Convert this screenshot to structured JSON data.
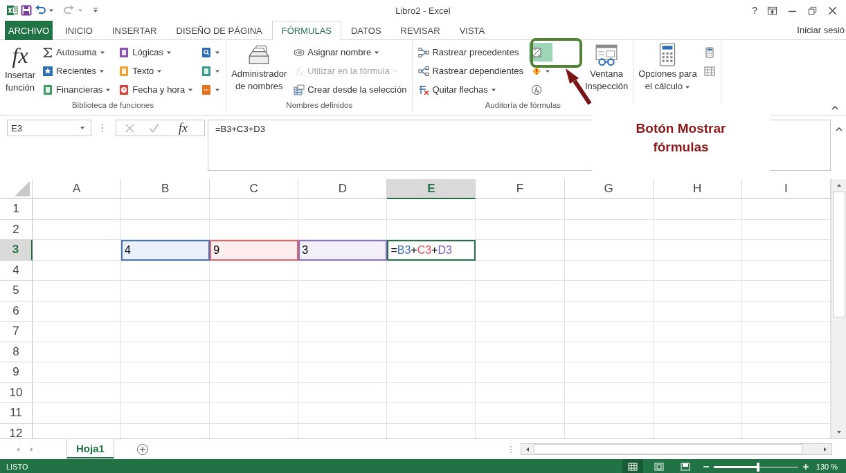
{
  "title_bar": {
    "title": "Libro2 - Excel",
    "help": "?"
  },
  "tabs": [
    {
      "label": "ARCHIVO",
      "kind": "file",
      "selected": false
    },
    {
      "label": "INICIO",
      "kind": "tab",
      "selected": false
    },
    {
      "label": "INSERTAR",
      "kind": "tab",
      "selected": false
    },
    {
      "label": "DISEÑO DE PÁGINA",
      "kind": "tab",
      "selected": false
    },
    {
      "label": "FÓRMULAS",
      "kind": "tab",
      "selected": true
    },
    {
      "label": "DATOS",
      "kind": "tab",
      "selected": false
    },
    {
      "label": "REVISAR",
      "kind": "tab",
      "selected": false
    },
    {
      "label": "VISTA",
      "kind": "tab",
      "selected": false
    }
  ],
  "account": "Iniciar sesió",
  "ribbon": {
    "groups": [
      {
        "label": "Biblioteca de funciones",
        "columns": [
          {
            "kind": "large",
            "icon_text": "fx",
            "label": "Insertar\nfunción",
            "dropdown": false
          },
          {
            "kind": "small",
            "items": [
              {
                "label": "Autosuma",
                "dropdown": true,
                "disabled": false,
                "on": false
              },
              {
                "label": "Recientes",
                "dropdown": true,
                "disabled": false,
                "on": false
              },
              {
                "label": "Financieras",
                "dropdown": true,
                "disabled": false,
                "on": false
              }
            ]
          },
          {
            "kind": "small",
            "items": [
              {
                "label": "Lógicas",
                "dropdown": true,
                "disabled": false,
                "on": false
              },
              {
                "label": "Texto",
                "dropdown": true,
                "disabled": false,
                "on": false
              },
              {
                "label": "Fecha y hora",
                "dropdown": true,
                "disabled": false,
                "on": false
              }
            ]
          },
          {
            "kind": "small",
            "items": [
              {
                "dropdown": true,
                "disabled": false,
                "on": false
              },
              {
                "dropdown": true,
                "disabled": false,
                "on": false
              },
              {
                "dropdown": true,
                "disabled": false,
                "on": false
              }
            ]
          }
        ]
      },
      {
        "label": "Nombres definidos",
        "columns": [
          {
            "kind": "large",
            "label": "Administrador\nde nombres",
            "dropdown": false
          },
          {
            "kind": "small",
            "items": [
              {
                "label": "Asignar nombre",
                "dropdown": true,
                "disabled": false,
                "on": false
              },
              {
                "label": "Utilizar en la fórmula",
                "dropdown": true,
                "disabled": true,
                "on": false
              },
              {
                "label": "Crear desde la selección",
                "dropdown": false,
                "disabled": false,
                "on": false
              }
            ]
          }
        ]
      },
      {
        "label": "Auditoría de fórmulas",
        "columns": [
          {
            "kind": "small",
            "items": [
              {
                "label": "Rastrear precedentes",
                "dropdown": false,
                "disabled": false,
                "on": false
              },
              {
                "label": "Rastrear dependientes",
                "dropdown": false,
                "disabled": false,
                "on": false
              },
              {
                "label": "Quitar flechas",
                "dropdown": true,
                "disabled": false,
                "on": false
              }
            ]
          },
          {
            "kind": "small",
            "items": [
              {
                "dropdown": false,
                "disabled": false,
                "on": true
              },
              {
                "dropdown": true,
                "disabled": false,
                "on": false
              },
              {
                "dropdown": false,
                "disabled": false,
                "on": false
              }
            ]
          },
          {
            "kind": "large",
            "label": "Ventana\nInspección",
            "dropdown": false
          }
        ]
      },
      {
        "columns": [
          {
            "kind": "large",
            "label": "Opciones para\nel cálculo",
            "dropdown": true
          },
          {
            "kind": "small",
            "items": [
              {
                "dropdown": false,
                "disabled": false,
                "on": false
              },
              {
                "dropdown": false,
                "disabled": false,
                "on": false
              }
            ]
          }
        ]
      }
    ]
  },
  "formula_bar": {
    "name_box": "E3",
    "fx": "fx",
    "formula": "=B3+C3+D3"
  },
  "grid": {
    "columns": [
      {
        "label": "A",
        "selected": false
      },
      {
        "label": "B",
        "selected": false
      },
      {
        "label": "C",
        "selected": false
      },
      {
        "label": "D",
        "selected": false
      },
      {
        "label": "E",
        "selected": true
      },
      {
        "label": "F",
        "selected": false
      },
      {
        "label": "G",
        "selected": false
      },
      {
        "label": "H",
        "selected": false
      },
      {
        "label": "I",
        "selected": false
      }
    ],
    "rows": [
      {
        "label": "1",
        "selected": false
      },
      {
        "label": "2",
        "selected": false
      },
      {
        "label": "3",
        "selected": true,
        "cells": [
          {
            "kind": "empty",
            "selected": false
          },
          {
            "kind": "value",
            "text": "4",
            "color": "#4472c4",
            "selected": false
          },
          {
            "kind": "value",
            "text": "9",
            "color": "#e06666",
            "selected": false
          },
          {
            "kind": "value",
            "text": "3",
            "color": "#8e6fc8",
            "selected": false
          },
          {
            "kind": "formula",
            "selected": true,
            "tokens": [
              {
                "text": "=",
                "color": "#000000"
              },
              {
                "text": "B3",
                "color": "#4472c4"
              },
              {
                "text": "+",
                "color": "#000000"
              },
              {
                "text": "C3",
                "color": "#e0504f"
              },
              {
                "text": "+",
                "color": "#000000"
              },
              {
                "text": "D3",
                "color": "#7e5fbf"
              }
            ]
          },
          {
            "kind": "empty",
            "selected": false
          },
          {
            "kind": "empty",
            "selected": false
          },
          {
            "kind": "empty",
            "selected": false
          },
          {
            "kind": "empty",
            "selected": false
          }
        ]
      },
      {
        "label": "4",
        "selected": false
      },
      {
        "label": "5",
        "selected": false
      },
      {
        "label": "6",
        "selected": false
      },
      {
        "label": "7",
        "selected": false
      },
      {
        "label": "8",
        "selected": false
      },
      {
        "label": "9",
        "selected": false
      },
      {
        "label": "10",
        "selected": false
      },
      {
        "label": "11",
        "selected": false
      },
      {
        "label": "12",
        "selected": false
      }
    ]
  },
  "sheets": [
    {
      "label": "Hoja1",
      "selected": true
    }
  ],
  "status_bar": {
    "status": "LISTO",
    "views": [
      {
        "selected": true
      },
      {
        "selected": false
      },
      {
        "selected": false
      }
    ],
    "zoom": {
      "level": 0.53,
      "reading": "130 %"
    }
  },
  "callout": {
    "text": "Botón Mostrar fórmulas"
  }
}
